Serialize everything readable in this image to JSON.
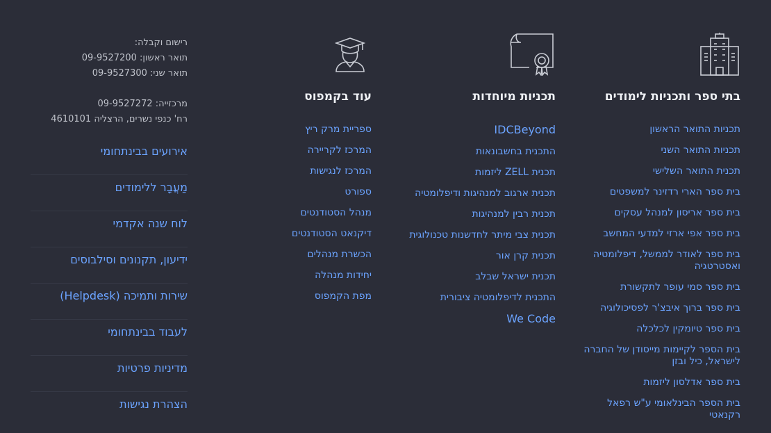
{
  "schools": {
    "title": "בתי ספר ותכניות לימודים",
    "icon": "building-icon",
    "items": [
      "תכניות התואר הראשון",
      "תכניות התואר השני",
      "תכנית התואר השלישי",
      "בית ספר הארי רדזינר למשפטים",
      "בית ספר אריסון למנהל עסקים",
      "בית ספר אפי ארזי למדעי המחשב",
      "בית ספר לאודר לממשל, דיפלומטיה ואסטרטגיה",
      "בית ספר סמי עופר לתקשורת",
      "בית ספר ברוך איבצ'ר לפסיכולוגיה",
      "בית ספר טיומקין לכלכלה",
      "בית הספר לקיימות מייסודן של החברה לישראל, כיל ובזן",
      "בית ספר אדלסון ליזמות",
      "בית הספר הבינלאומי ע\"ש רפאל רקנאטי"
    ]
  },
  "special": {
    "title": "תכניות מיוחדות",
    "icon": "certificate-icon",
    "items": [
      "IDCBeyond",
      "התכנית בחשבונאות",
      "תכנית ZELL ליזמות",
      "תכנית ארגוב למנהיגות ודיפלומטיה",
      "תכנית רבין למנהיגות",
      "תכנית צבי מיתר לחדשנות טכנולוגית",
      "תכנית קרן אור",
      "תכנית ישראל שבלב",
      "התכנית לדיפלומטיה ציבורית",
      "We Code"
    ]
  },
  "campus": {
    "title": "עוד בקמפוס",
    "icon": "graduate-icon",
    "items": [
      "ספריית מרק ריץ",
      "המרכז לקריירה",
      "המרכז לנגישות",
      "ספורט",
      "מנהל הסטודנטים",
      "דיקנאט הסטודנטים",
      "הכשרת מנהלים",
      "יחידות מנהלה",
      "מפת הקמפוס"
    ]
  },
  "contact": {
    "registration_label": "רישום וקבלה:",
    "ba_line": "תואר ראשון: 09-9527200",
    "ma_line": "תואר שני: 09-9527300",
    "switchboard_line": "מרכזייה: 09-9527272",
    "address_line": "רח' כנפי נשרים, הרצליה 4610101"
  },
  "quick_links": [
    "אירועים בבינתחומי",
    "מַעֲבָר ללימודים",
    "לוח שנה אקדמי",
    "ידיעון, תקנונים וסילבוסים",
    "שירות ותמיכה (Helpdesk)",
    "לעבוד בבינתחומי",
    "מדיניות פרטיות",
    "הצהרת נגישות"
  ],
  "colors": {
    "background": "#2b2d38",
    "link": "#6ba3ff",
    "heading": "#eef0f4"
  }
}
